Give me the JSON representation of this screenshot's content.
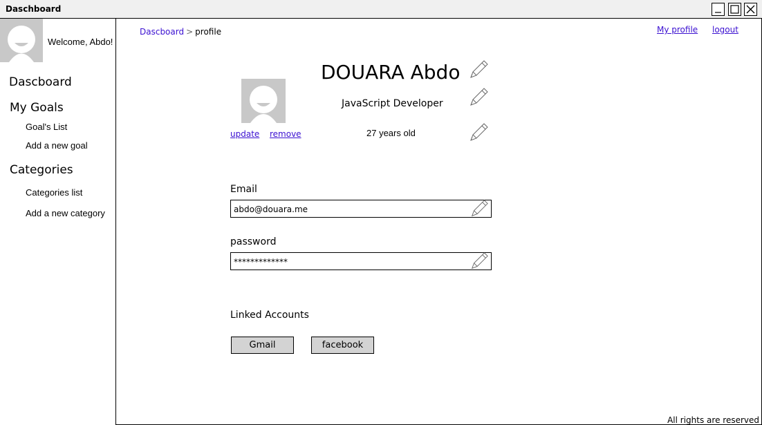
{
  "window": {
    "title": "Daschboard"
  },
  "sidebar": {
    "welcome": "Welcome, Abdo!",
    "dashboard": "Dascboard",
    "goals": {
      "heading": "My Goals",
      "items": [
        "Goal's List",
        "Add a new goal"
      ]
    },
    "categories": {
      "heading": "Categories",
      "items": [
        "Categories list",
        "Add a new category"
      ]
    }
  },
  "breadcrumb": {
    "home": "Dascboard",
    "separator": ">",
    "current": "profile"
  },
  "header_links": {
    "profile": "My profile",
    "logout": "logout"
  },
  "profile": {
    "name": "DOUARA Abdo",
    "job": "JavaScript Developer",
    "age": "27 years old",
    "update": "update",
    "remove": "remove"
  },
  "fields": {
    "email_label": "Email",
    "email_value": "abdo@douara.me",
    "password_label": "password",
    "password_value": "*************"
  },
  "linked": {
    "heading": "Linked Accounts",
    "gmail": "Gmail",
    "facebook": "facebook"
  },
  "footer": "All rights are reserved",
  "icons": {
    "edit": "pencil-icon",
    "avatar": "user-avatar-icon"
  },
  "colors": {
    "link": "#3a0fd1",
    "avatar_bg": "#c8c8c8",
    "button_bg": "#d3d3d3"
  }
}
